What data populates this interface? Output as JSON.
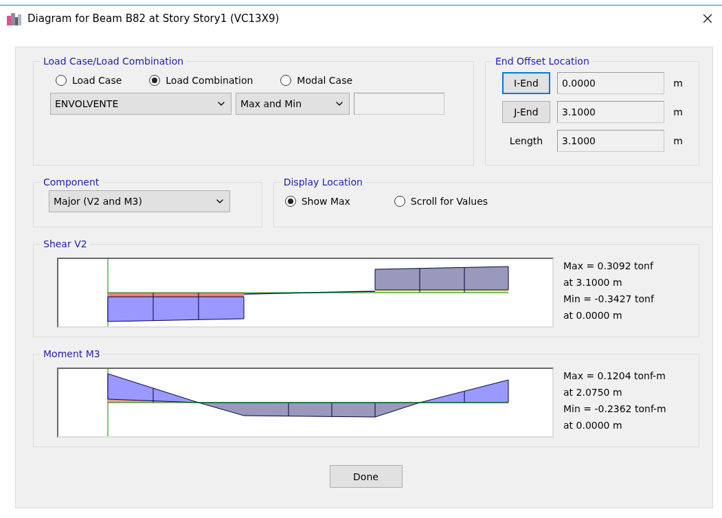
{
  "window": {
    "title": "Diagram for Beam B82 at Story Story1 (VC13X9)"
  },
  "load_case": {
    "legend": "Load Case/Load Combination",
    "options": [
      {
        "label": "Load Case",
        "selected": false
      },
      {
        "label": "Load Combination",
        "selected": true
      },
      {
        "label": "Modal Case",
        "selected": false
      }
    ],
    "combination": "ENVOLVENTE",
    "type": "Max and Min"
  },
  "end_offset": {
    "legend": "End Offset Location",
    "rows": [
      {
        "kind": "button",
        "label": "I-End",
        "focused": true,
        "value": "0.0000",
        "unit": "m"
      },
      {
        "kind": "button",
        "label": "J-End",
        "focused": false,
        "value": "3.1000",
        "unit": "m"
      },
      {
        "kind": "label",
        "label": "Length",
        "value": "3.1000",
        "unit": "m"
      }
    ]
  },
  "component": {
    "legend": "Component",
    "value": "Major (V2 and M3)"
  },
  "display_location": {
    "legend": "Display Location",
    "options": [
      {
        "label": "Show Max",
        "selected": true
      },
      {
        "label": "Scroll for Values",
        "selected": false
      }
    ]
  },
  "diagrams": [
    {
      "kind": "shear",
      "title": "Shear V2",
      "lines": [
        "Max = 0.3092 tonf",
        "at 3.1000 m",
        "Min = -0.3427 tonf",
        "at 0.0000 m"
      ]
    },
    {
      "kind": "moment",
      "title": "Moment M3",
      "lines": [
        "Max = 0.1204 tonf-m",
        "at 2.0750 m",
        "Min = -0.2362 tonf-m",
        "at 0.0000 m"
      ]
    }
  ],
  "buttons": [
    "Done"
  ]
}
